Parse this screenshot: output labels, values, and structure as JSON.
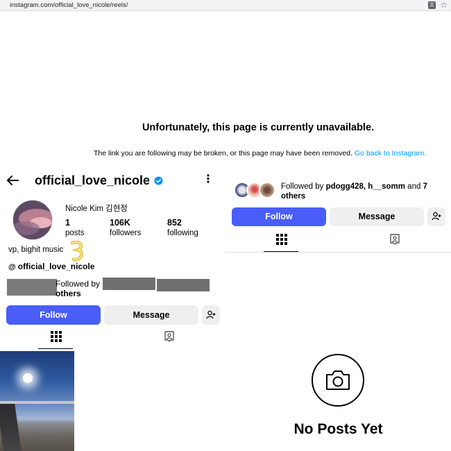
{
  "browser": {
    "url": "instagram.com/official_love_nicole/reels/",
    "translate_icon": "translate-icon",
    "star_icon": "star-icon"
  },
  "unavailable": {
    "title": "Unfortunately, this page is currently unavailable.",
    "description": "The link you are following may be broken, or this page may have been removed.",
    "link_text": "Go back to Instagram."
  },
  "profile": {
    "username": "official_love_nicole",
    "display_name": "Nicole Kim 김현정",
    "stats": [
      {
        "value": "1",
        "label": "posts"
      },
      {
        "value": "106K",
        "label": "followers"
      },
      {
        "value": "852",
        "label": "following"
      }
    ],
    "bio": "vp, bighit music",
    "threads_handle": "official_love_nicole",
    "followed_by_prefix": "Followed by",
    "followed_by_suffix": "others",
    "follow_label": "Follow",
    "message_label": "Message"
  },
  "right_panel": {
    "followed_by_prefix": "Followed by",
    "followed_by_names": "pdogg428, h__somm",
    "followed_by_and": "and",
    "followed_by_count": "7",
    "followed_by_others": "others",
    "follow_label": "Follow",
    "message_label": "Message",
    "empty_title": "No Posts Yet"
  },
  "colors": {
    "follow_button": "#4a5df9",
    "secondary_button": "#efefef",
    "link": "#0095f6",
    "verified": "#0095f6"
  }
}
